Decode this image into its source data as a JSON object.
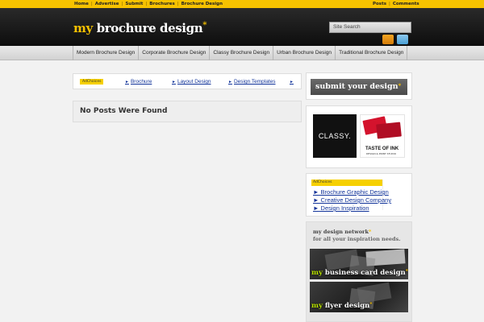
{
  "topbar": {
    "left_links": [
      "Home",
      "Advertise",
      "Submit",
      "Brochures",
      "Brochure Design"
    ],
    "right_links": [
      "Posts",
      "Comments"
    ]
  },
  "header": {
    "logo_my": "my",
    "logo_rest": "brochure design",
    "logo_star": "*",
    "search_placeholder": "Site Search"
  },
  "nav": {
    "items": [
      "Modern Brochure Design",
      "Corporate Brochure Design",
      "Classy Brochure Design",
      "Urban Brochure Design",
      "Traditional Brochure Design"
    ]
  },
  "ad_bar": {
    "adchoices": "AdChoices",
    "links": [
      "Brochure",
      "Layout Design",
      "Design Templates"
    ]
  },
  "main": {
    "no_posts": "No Posts Were Found"
  },
  "sidebar": {
    "submit_label": "submit your design",
    "submit_star": "*",
    "classy_text": "CLASSY.",
    "taste_text": "TASTE OF INK",
    "taste_sub": "DESIGN & PRINT STUDIO",
    "adchoices": "AdChoices",
    "ad_links": [
      "Brochure Graphic Design",
      "Creative Design Company",
      "Design Inspiration"
    ],
    "network_title": "my design network",
    "network_star": "*",
    "network_sub": "for all your inspiration needs.",
    "banners": [
      {
        "my": "my",
        "rest": " business card design",
        "star": "*"
      },
      {
        "my": "my",
        "rest": " flyer design",
        "star": "*"
      }
    ]
  },
  "colors": {
    "accent": "#f6c200",
    "header_bg": "#111111",
    "link": "#113399"
  }
}
